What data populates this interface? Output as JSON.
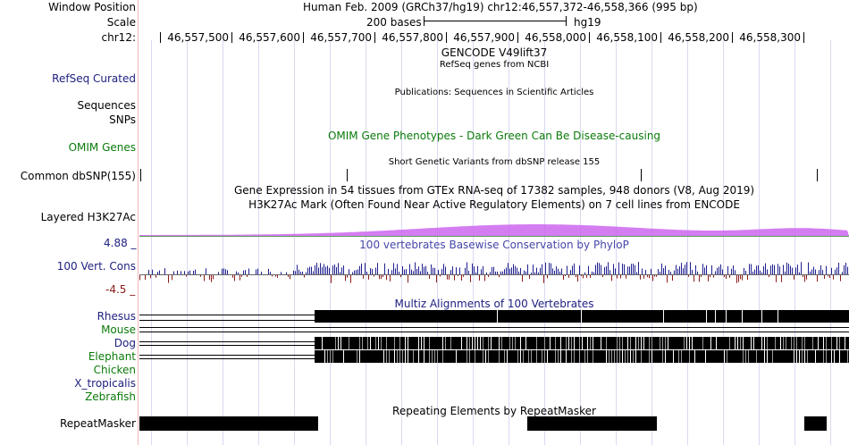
{
  "header": {
    "window_position_label": "Window Position",
    "window_position_value": "Human Feb. 2009 (GRCh37/hg19)   chr12:46,557,372-46,558,366 (995 bp)",
    "scale_label": "Scale",
    "scale_bases": "200 bases",
    "scale_assembly": "hg19",
    "chrom_label": "chr12:",
    "ruler_ticks": [
      "46,557,500",
      "46,557,600",
      "46,557,700",
      "46,557,800",
      "46,557,900",
      "46,558,000",
      "46,558,100",
      "46,558,200",
      "46,558,300"
    ]
  },
  "tracks": {
    "gencode_title": "GENCODE V49lift37",
    "refseq_label": "RefSeq Curated",
    "refseq_title": "RefSeq genes from NCBI",
    "publications_title": "Publications: Sequences in Scientific Articles",
    "sequences_label": "Sequences",
    "snps_label": "SNPs",
    "omim_label": "OMIM Genes",
    "omim_title": "OMIM Gene Phenotypes - Dark Green Can Be Disease-causing",
    "dbsnp_title": "Short Genetic Variants from dbSNP release 155",
    "dbsnp_label": "Common dbSNP(155)",
    "gtex_title": "Gene Expression in 54 tissues from GTEx RNA-seq of 17382 samples, 948 donors (V8, Aug 2019)",
    "h3k27ac_title": "H3K27Ac Mark (Often Found Near Active Regulatory Elements) on 7 cell lines from ENCODE",
    "h3k27ac_label": "Layered H3K27Ac",
    "phylop_max": "4.88 _",
    "phylop_title": "100 vertebrates Basewise Conservation by PhyloP",
    "phylop_label": "100 Vert. Cons",
    "phylop_min": "-4.5 _",
    "multiz_title": "Multiz Alignments of 100 Vertebrates",
    "species": [
      "Rhesus",
      "Mouse",
      "Dog",
      "Elephant",
      "Chicken",
      "X_tropicalis",
      "Zebrafish"
    ],
    "repeat_title": "Repeating Elements by RepeatMasker",
    "repeat_label": "RepeatMasker"
  },
  "colors": {
    "label_blue": "#1f2180",
    "label_green": "#0b7a0b",
    "phylop_pos": "#1f1f8f",
    "phylop_neg": "#8b1a1a",
    "h3k27ac": "#cc66ee",
    "grid": "#d9d9f2"
  }
}
